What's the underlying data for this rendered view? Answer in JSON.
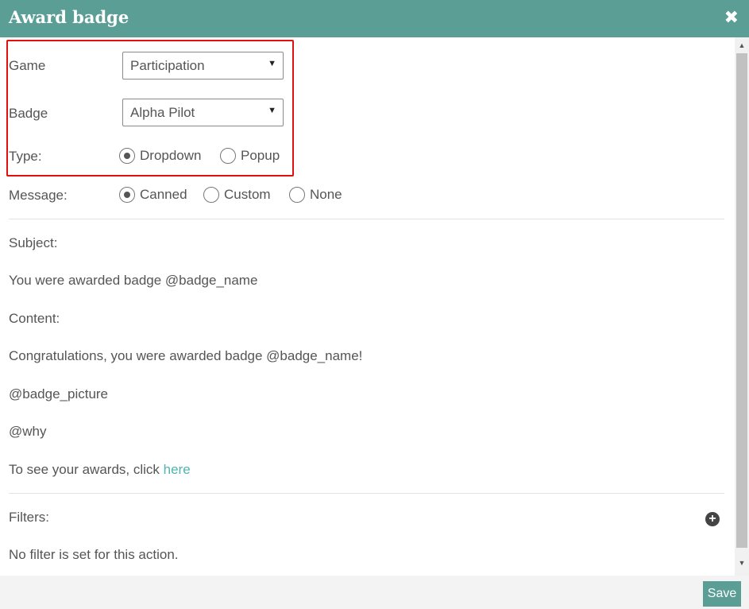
{
  "dialog": {
    "title": "Award badge",
    "close_icon": "close-icon"
  },
  "form": {
    "game_label": "Game",
    "game_value": "Participation",
    "badge_label": "Badge",
    "badge_value": "Alpha Pilot",
    "type_label": "Type:",
    "type_options": [
      "Dropdown",
      "Popup"
    ],
    "type_selected": "Dropdown",
    "message_label": "Message:",
    "message_options": [
      "Canned",
      "Custom",
      "None"
    ],
    "message_selected": "Canned"
  },
  "message": {
    "subject_label": "Subject:",
    "subject_text": "You were awarded badge @badge_name",
    "content_label": "Content:",
    "content_line1": "Congratulations, you were awarded badge @badge_name!",
    "content_line2": "@badge_picture",
    "content_line3": "@why",
    "content_line4_prefix": "To see your awards, click ",
    "content_link": "here"
  },
  "filters": {
    "label": "Filters:",
    "empty_text": "No filter is set for this action.",
    "add_icon": "plus-circle-icon"
  },
  "footer": {
    "save_label": "Save"
  },
  "colors": {
    "header": "#5a9e96",
    "highlight_border": "#e01010",
    "link": "#4fb5ad"
  }
}
